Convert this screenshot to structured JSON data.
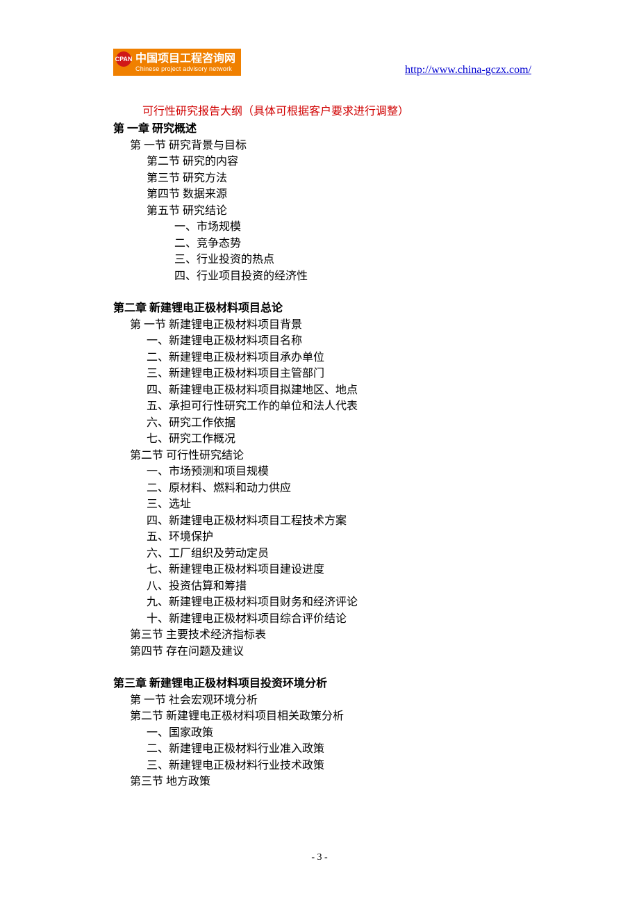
{
  "logo": {
    "badge": "CPAN",
    "name_cn": "中国项目工程咨询网",
    "name_en": "Chinese project advisory network"
  },
  "url": "http://www.china-gczx.com/",
  "title": "可行性研究报告大纲（具体可根据客户要求进行调整）",
  "chapters": [
    {
      "heading": "第 一章  研究概述",
      "sections": [
        {
          "label": "第 一节 研究背景与目标",
          "indent": 1
        },
        {
          "label": "第二节 研究的内容",
          "indent": 2
        },
        {
          "label": "第三节 研究方法",
          "indent": 2
        },
        {
          "label": "第四节 数据来源",
          "indent": 2
        },
        {
          "label": "第五节 研究结论",
          "indent": 2
        },
        {
          "label": "一、市场规模",
          "indent": 3
        },
        {
          "label": "二、竞争态势",
          "indent": 3
        },
        {
          "label": "三、行业投资的热点",
          "indent": 3
        },
        {
          "label": "四、行业项目投资的经济性",
          "indent": 3
        }
      ]
    },
    {
      "heading": "第二章 新建锂电正极材料项目总论",
      "sections": [
        {
          "label": "第 一节 新建锂电正极材料项目背景",
          "indent": 1
        },
        {
          "label": "一、新建锂电正极材料项目名称",
          "indent": 2
        },
        {
          "label": "二、新建锂电正极材料项目承办单位",
          "indent": 2
        },
        {
          "label": "三、新建锂电正极材料项目主管部门",
          "indent": 2
        },
        {
          "label": "四、新建锂电正极材料项目拟建地区、地点",
          "indent": 2
        },
        {
          "label": "五、承担可行性研究工作的单位和法人代表",
          "indent": 2
        },
        {
          "label": "六、研究工作依据",
          "indent": 2
        },
        {
          "label": "七、研究工作概况",
          "indent": 2
        },
        {
          "label": "第二节  可行性研究结论",
          "indent": 1
        },
        {
          "label": "一、市场预测和项目规模",
          "indent": 2
        },
        {
          "label": "二、原材料、燃料和动力供应",
          "indent": 2
        },
        {
          "label": "三、选址",
          "indent": 2
        },
        {
          "label": "四、新建锂电正极材料项目工程技术方案",
          "indent": 2
        },
        {
          "label": "五、环境保护",
          "indent": 2
        },
        {
          "label": "六、工厂组织及劳动定员",
          "indent": 2
        },
        {
          "label": "七、新建锂电正极材料项目建设进度",
          "indent": 2
        },
        {
          "label": "八、投资估算和筹措",
          "indent": 2
        },
        {
          "label": "九、新建锂电正极材料项目财务和经济评论",
          "indent": 2
        },
        {
          "label": "十、新建锂电正极材料项目综合评价结论",
          "indent": 2
        },
        {
          "label": "第三节  主要技术经济指标表",
          "indent": 1
        },
        {
          "label": "第四节  存在问题及建议",
          "indent": 1
        }
      ]
    },
    {
      "heading": "第三章 新建锂电正极材料项目投资环境分析",
      "sections": [
        {
          "label": "第 一节  社会宏观环境分析",
          "indent": 1
        },
        {
          "label": "第二节 新建锂电正极材料项目相关政策分析",
          "indent": 1
        },
        {
          "label": "一、国家政策",
          "indent": 2
        },
        {
          "label": "二、新建锂电正极材料行业准入政策",
          "indent": 2
        },
        {
          "label": "三、新建锂电正极材料行业技术政策",
          "indent": 2
        },
        {
          "label": "第三节  地方政策",
          "indent": 1
        }
      ]
    }
  ],
  "page_number": "- 3 -"
}
